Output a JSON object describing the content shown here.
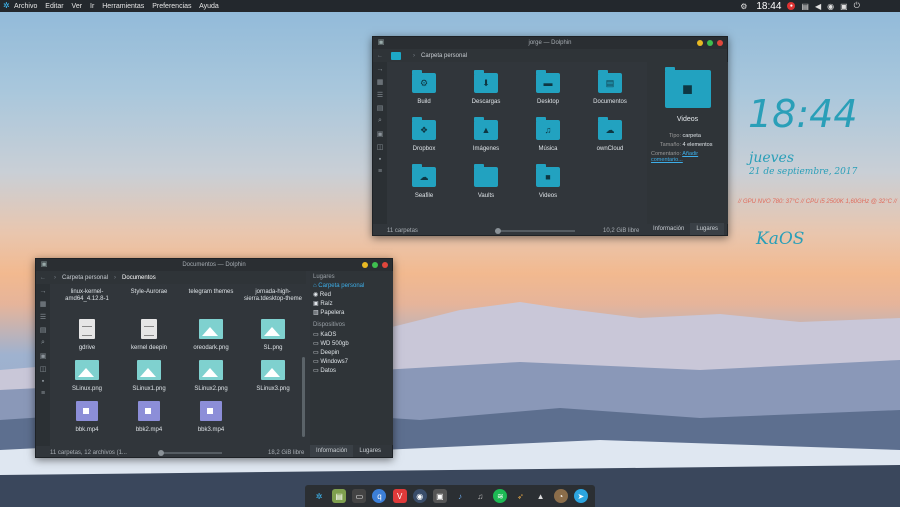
{
  "topbar": {
    "menu": [
      "Archivo",
      "Editar",
      "Ver",
      "Ir",
      "Herramientas",
      "Preferencias",
      "Ayuda"
    ],
    "clock": "18:44"
  },
  "desktop": {
    "clock": "18:44",
    "day": "jueves",
    "date": "21 de septiembre, 2017",
    "sysline": "// GPU NVO 780: 37°C // CPU i5 2500K 1,60GHz @ 32°C //",
    "brand": "KaOS"
  },
  "dolphin_home": {
    "title": "jorge — Dolphin",
    "breadcrumb": "Carpeta personal",
    "items": [
      {
        "label": "Build",
        "glyph": "⚙"
      },
      {
        "label": "Descargas",
        "glyph": "⬇"
      },
      {
        "label": "Desktop",
        "glyph": "▬"
      },
      {
        "label": "Documentos",
        "glyph": "▤"
      },
      {
        "label": "Dropbox",
        "glyph": "❖"
      },
      {
        "label": "Imágenes",
        "glyph": "▲"
      },
      {
        "label": "Música",
        "glyph": "♫"
      },
      {
        "label": "ownCloud",
        "glyph": "☁"
      },
      {
        "label": "Seafile",
        "glyph": "☁"
      },
      {
        "label": "Vaults",
        "glyph": ""
      },
      {
        "label": "Videos",
        "glyph": "■"
      }
    ],
    "info": {
      "name": "Videos",
      "rows": [
        {
          "k": "Tipo:",
          "v": "carpeta"
        },
        {
          "k": "Tamaño:",
          "v": "4 elementos"
        },
        {
          "k": "Comentario:",
          "v": "Añadir comentario..."
        }
      ]
    },
    "status_left": "11 carpetas",
    "status_free": "10,2 GiB libre",
    "tabs": [
      "Información",
      "Lugares"
    ]
  },
  "dolphin_docs": {
    "title": "Documentos — Dolphin",
    "breadcrumb": [
      "Carpeta personal",
      "Documentos"
    ],
    "top_labels": [
      "linux-kernel-amd64_4.12.8-1",
      "Style-Aurorae",
      "telegram themes",
      "jornada-high-sierra.tdesktop-theme"
    ],
    "files": [
      {
        "label": "gdrive",
        "kind": "doc"
      },
      {
        "label": "kernel deepin",
        "kind": "doc"
      },
      {
        "label": "oreodark.png",
        "kind": "img"
      },
      {
        "label": "SL.png",
        "kind": "img"
      },
      {
        "label": "SLinux.png",
        "kind": "img"
      },
      {
        "label": "SLinux1.png",
        "kind": "img"
      },
      {
        "label": "SLinux2.png",
        "kind": "img"
      },
      {
        "label": "SLinux3.png",
        "kind": "img"
      },
      {
        "label": "bbk.mp4",
        "kind": "vid"
      },
      {
        "label": "bbk2.mp4",
        "kind": "vid"
      },
      {
        "label": "bbk3.mp4",
        "kind": "vid"
      }
    ],
    "places_header": "Lugares",
    "places": [
      "Carpeta personal",
      "Red",
      "Raíz",
      "Papelera"
    ],
    "devices_header": "Dispositivos",
    "devices": [
      "KaOS",
      "WD 500gb",
      "Deepin",
      "Windows7",
      "Datos"
    ],
    "status_left": "11 carpetas, 12 archivos (1...",
    "status_free": "18,2 GiB libre",
    "tabs": [
      "Información",
      "Lugares"
    ]
  },
  "colors": {
    "accent": "#22a2c0",
    "panel": "#31363b"
  }
}
